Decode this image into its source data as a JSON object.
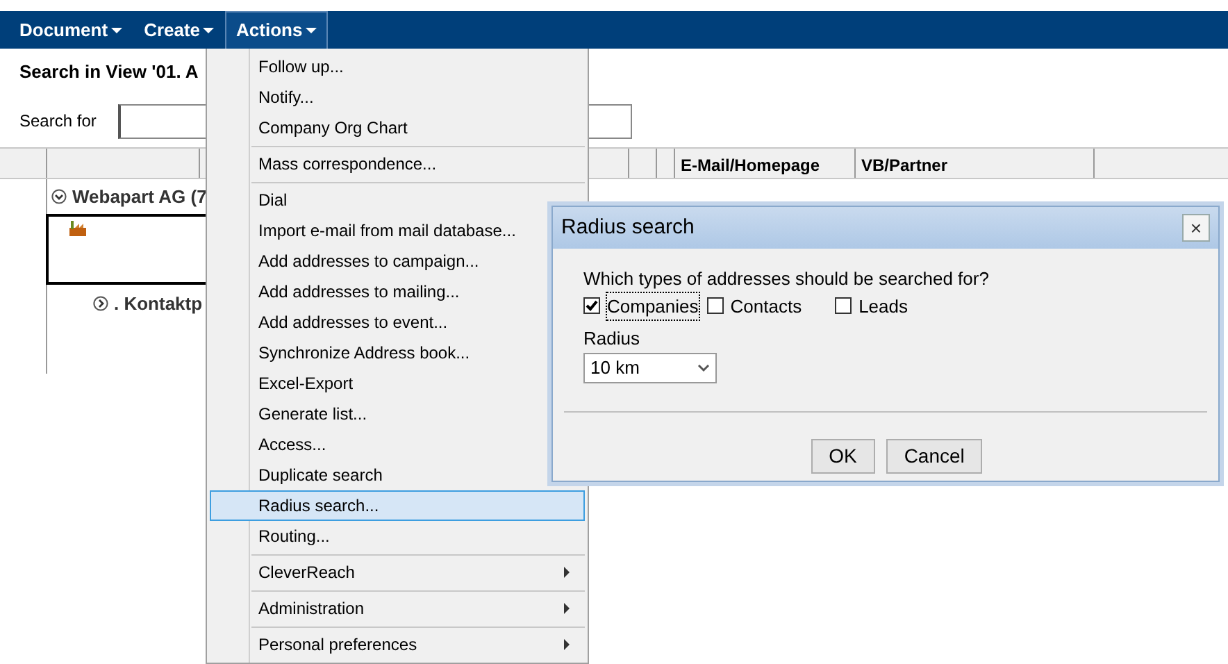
{
  "top_menu": [
    {
      "label": "Document",
      "selected": false
    },
    {
      "label": "Create",
      "selected": false
    },
    {
      "label": "Actions",
      "selected": true
    }
  ],
  "view": {
    "title": "Search in View '01. A",
    "search_label": "Search for",
    "columns": [
      "E-Mail/Homepage",
      "VB/Partner"
    ],
    "tree": [
      {
        "label": "Webapart AG (7",
        "expanded": true,
        "children": [
          {
            "label": ". Kontaktp",
            "expanded": false
          }
        ]
      }
    ]
  },
  "actions_menu": [
    [
      {
        "label": "Follow up...",
        "selected": false,
        "submenu": false
      },
      {
        "label": "Notify...",
        "selected": false,
        "submenu": false
      },
      {
        "label": "Company Org Chart",
        "selected": false,
        "submenu": false
      }
    ],
    [
      {
        "label": "Mass correspondence...",
        "selected": false,
        "submenu": false
      }
    ],
    [
      {
        "label": "Dial",
        "selected": false,
        "submenu": false
      },
      {
        "label": "Import e-mail from mail database...",
        "selected": false,
        "submenu": false
      },
      {
        "label": "Add addresses to campaign...",
        "selected": false,
        "submenu": false
      },
      {
        "label": "Add addresses to mailing...",
        "selected": false,
        "submenu": false
      },
      {
        "label": "Add addresses to event...",
        "selected": false,
        "submenu": false
      },
      {
        "label": "Synchronize Address book...",
        "selected": false,
        "submenu": false
      },
      {
        "label": "Excel-Export",
        "selected": false,
        "submenu": false
      },
      {
        "label": "Generate list...",
        "selected": false,
        "submenu": false
      },
      {
        "label": "Access...",
        "selected": false,
        "submenu": false
      },
      {
        "label": "Duplicate search",
        "selected": false,
        "submenu": false
      },
      {
        "label": "Radius search...",
        "selected": true,
        "submenu": false
      },
      {
        "label": "Routing...",
        "selected": false,
        "submenu": false
      }
    ],
    [
      {
        "label": "CleverReach",
        "selected": false,
        "submenu": true
      }
    ],
    [
      {
        "label": "Administration",
        "selected": false,
        "submenu": true
      }
    ],
    [
      {
        "label": "Personal preferences",
        "selected": false,
        "submenu": true
      }
    ]
  ],
  "dialog": {
    "title": "Radius search",
    "close": "×",
    "question": "Which types of addresses should be searched for?",
    "options": [
      {
        "label": "Companies",
        "checked": true
      },
      {
        "label": "Contacts",
        "checked": false
      },
      {
        "label": "Leads",
        "checked": false
      }
    ],
    "radius_label": "Radius",
    "radius_value": "10 km",
    "buttons": [
      "OK",
      "Cancel"
    ]
  }
}
